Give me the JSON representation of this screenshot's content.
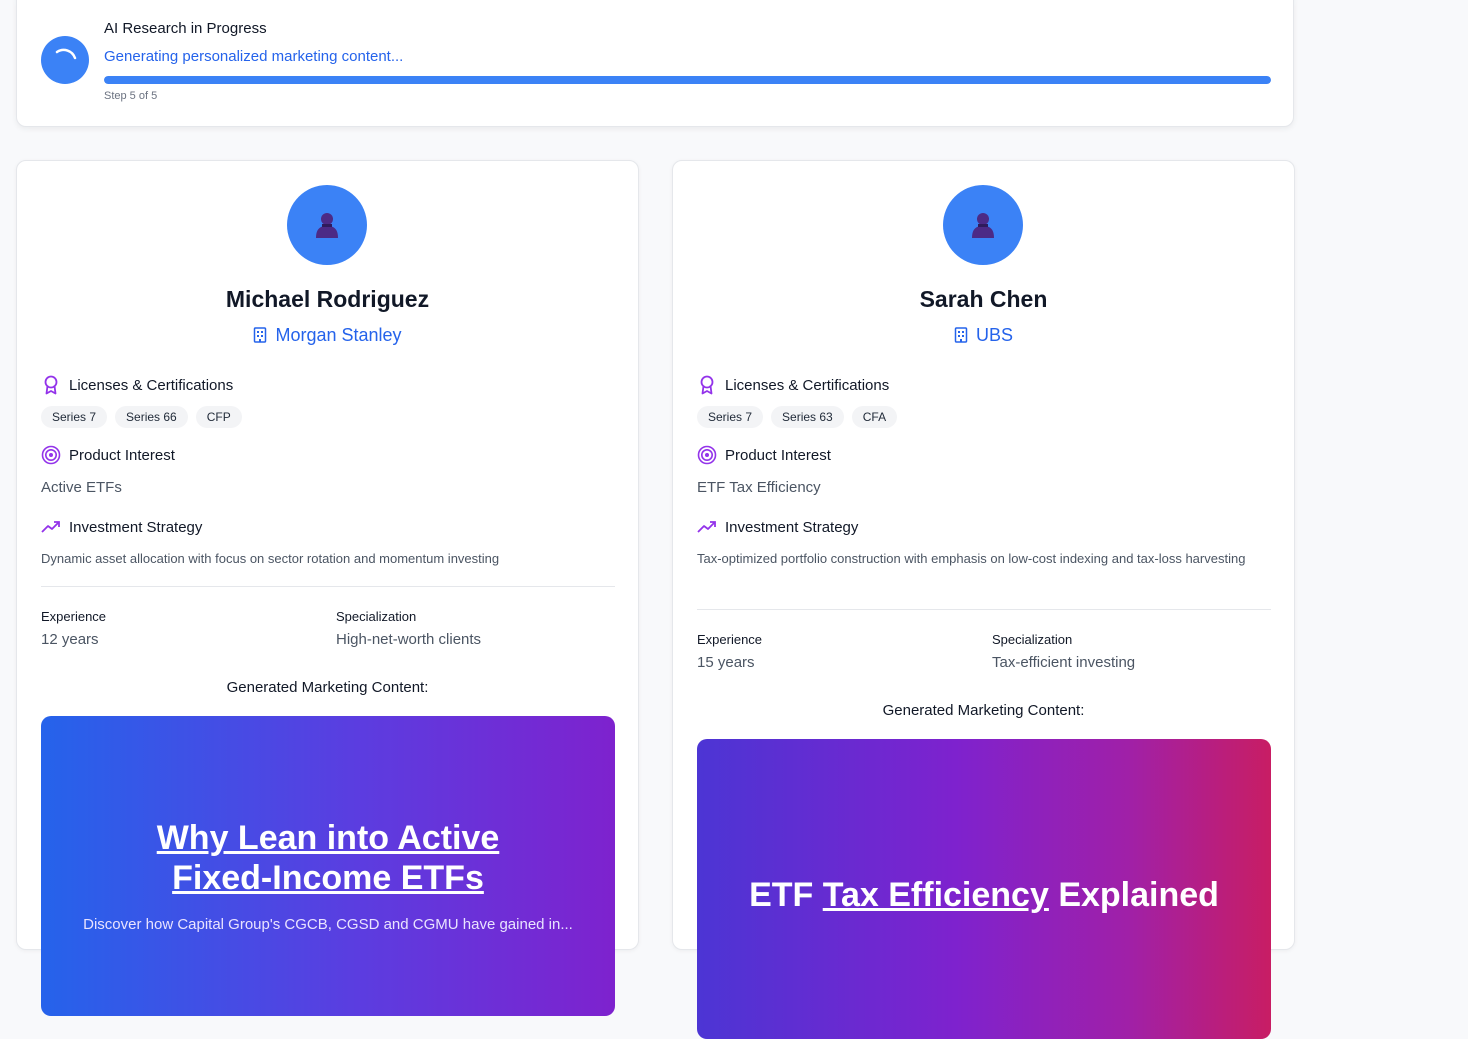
{
  "progress": {
    "title": "AI Research in Progress",
    "subtitle": "Generating personalized marketing content...",
    "step": "Step 5 of 5",
    "percent": 100,
    "color": "#3b82f6"
  },
  "advisors": [
    {
      "name": "Michael Rodriguez",
      "firm": "Morgan Stanley",
      "licenses_heading": "Licenses & Certifications",
      "licenses": [
        "Series 7",
        "Series 66",
        "CFP"
      ],
      "product_heading": "Product Interest",
      "product_interest": "Active ETFs",
      "strategy_heading": "Investment Strategy",
      "strategy": "Dynamic asset allocation with focus on sector rotation and momentum investing",
      "experience_label": "Experience",
      "experience": "12 years",
      "specialization_label": "Specialization",
      "specialization": "High-net-worth clients",
      "generated_label": "Generated Marketing Content:",
      "content": {
        "title_line1": "Why Lean into Active",
        "title_line2": "Fixed-Income ETFs",
        "subtitle": "Discover how Capital Group's CGCB, CGSD and CGMU have gained in..."
      }
    },
    {
      "name": "Sarah Chen",
      "firm": "UBS",
      "licenses_heading": "Licenses & Certifications",
      "licenses": [
        "Series 7",
        "Series 63",
        "CFA"
      ],
      "product_heading": "Product Interest",
      "product_interest": "ETF Tax Efficiency",
      "strategy_heading": "Investment Strategy",
      "strategy": "Tax-optimized portfolio construction with emphasis on low-cost indexing and tax-loss harvesting",
      "experience_label": "Experience",
      "experience": "15 years",
      "specialization_label": "Specialization",
      "specialization": "Tax-efficient investing",
      "generated_label": "Generated Marketing Content:",
      "content": {
        "title_prefix": "ETF ",
        "title_link": "Tax Efficiency",
        "title_suffix": " Explained"
      }
    }
  ],
  "icons": {
    "spinner": "spinner-icon",
    "avatar": "user-icon",
    "firm": "building-icon",
    "licenses": "award-icon",
    "product": "target-icon",
    "strategy": "trending-up-icon"
  },
  "colors": {
    "accent": "#2563eb",
    "purple": "#9333ea"
  }
}
